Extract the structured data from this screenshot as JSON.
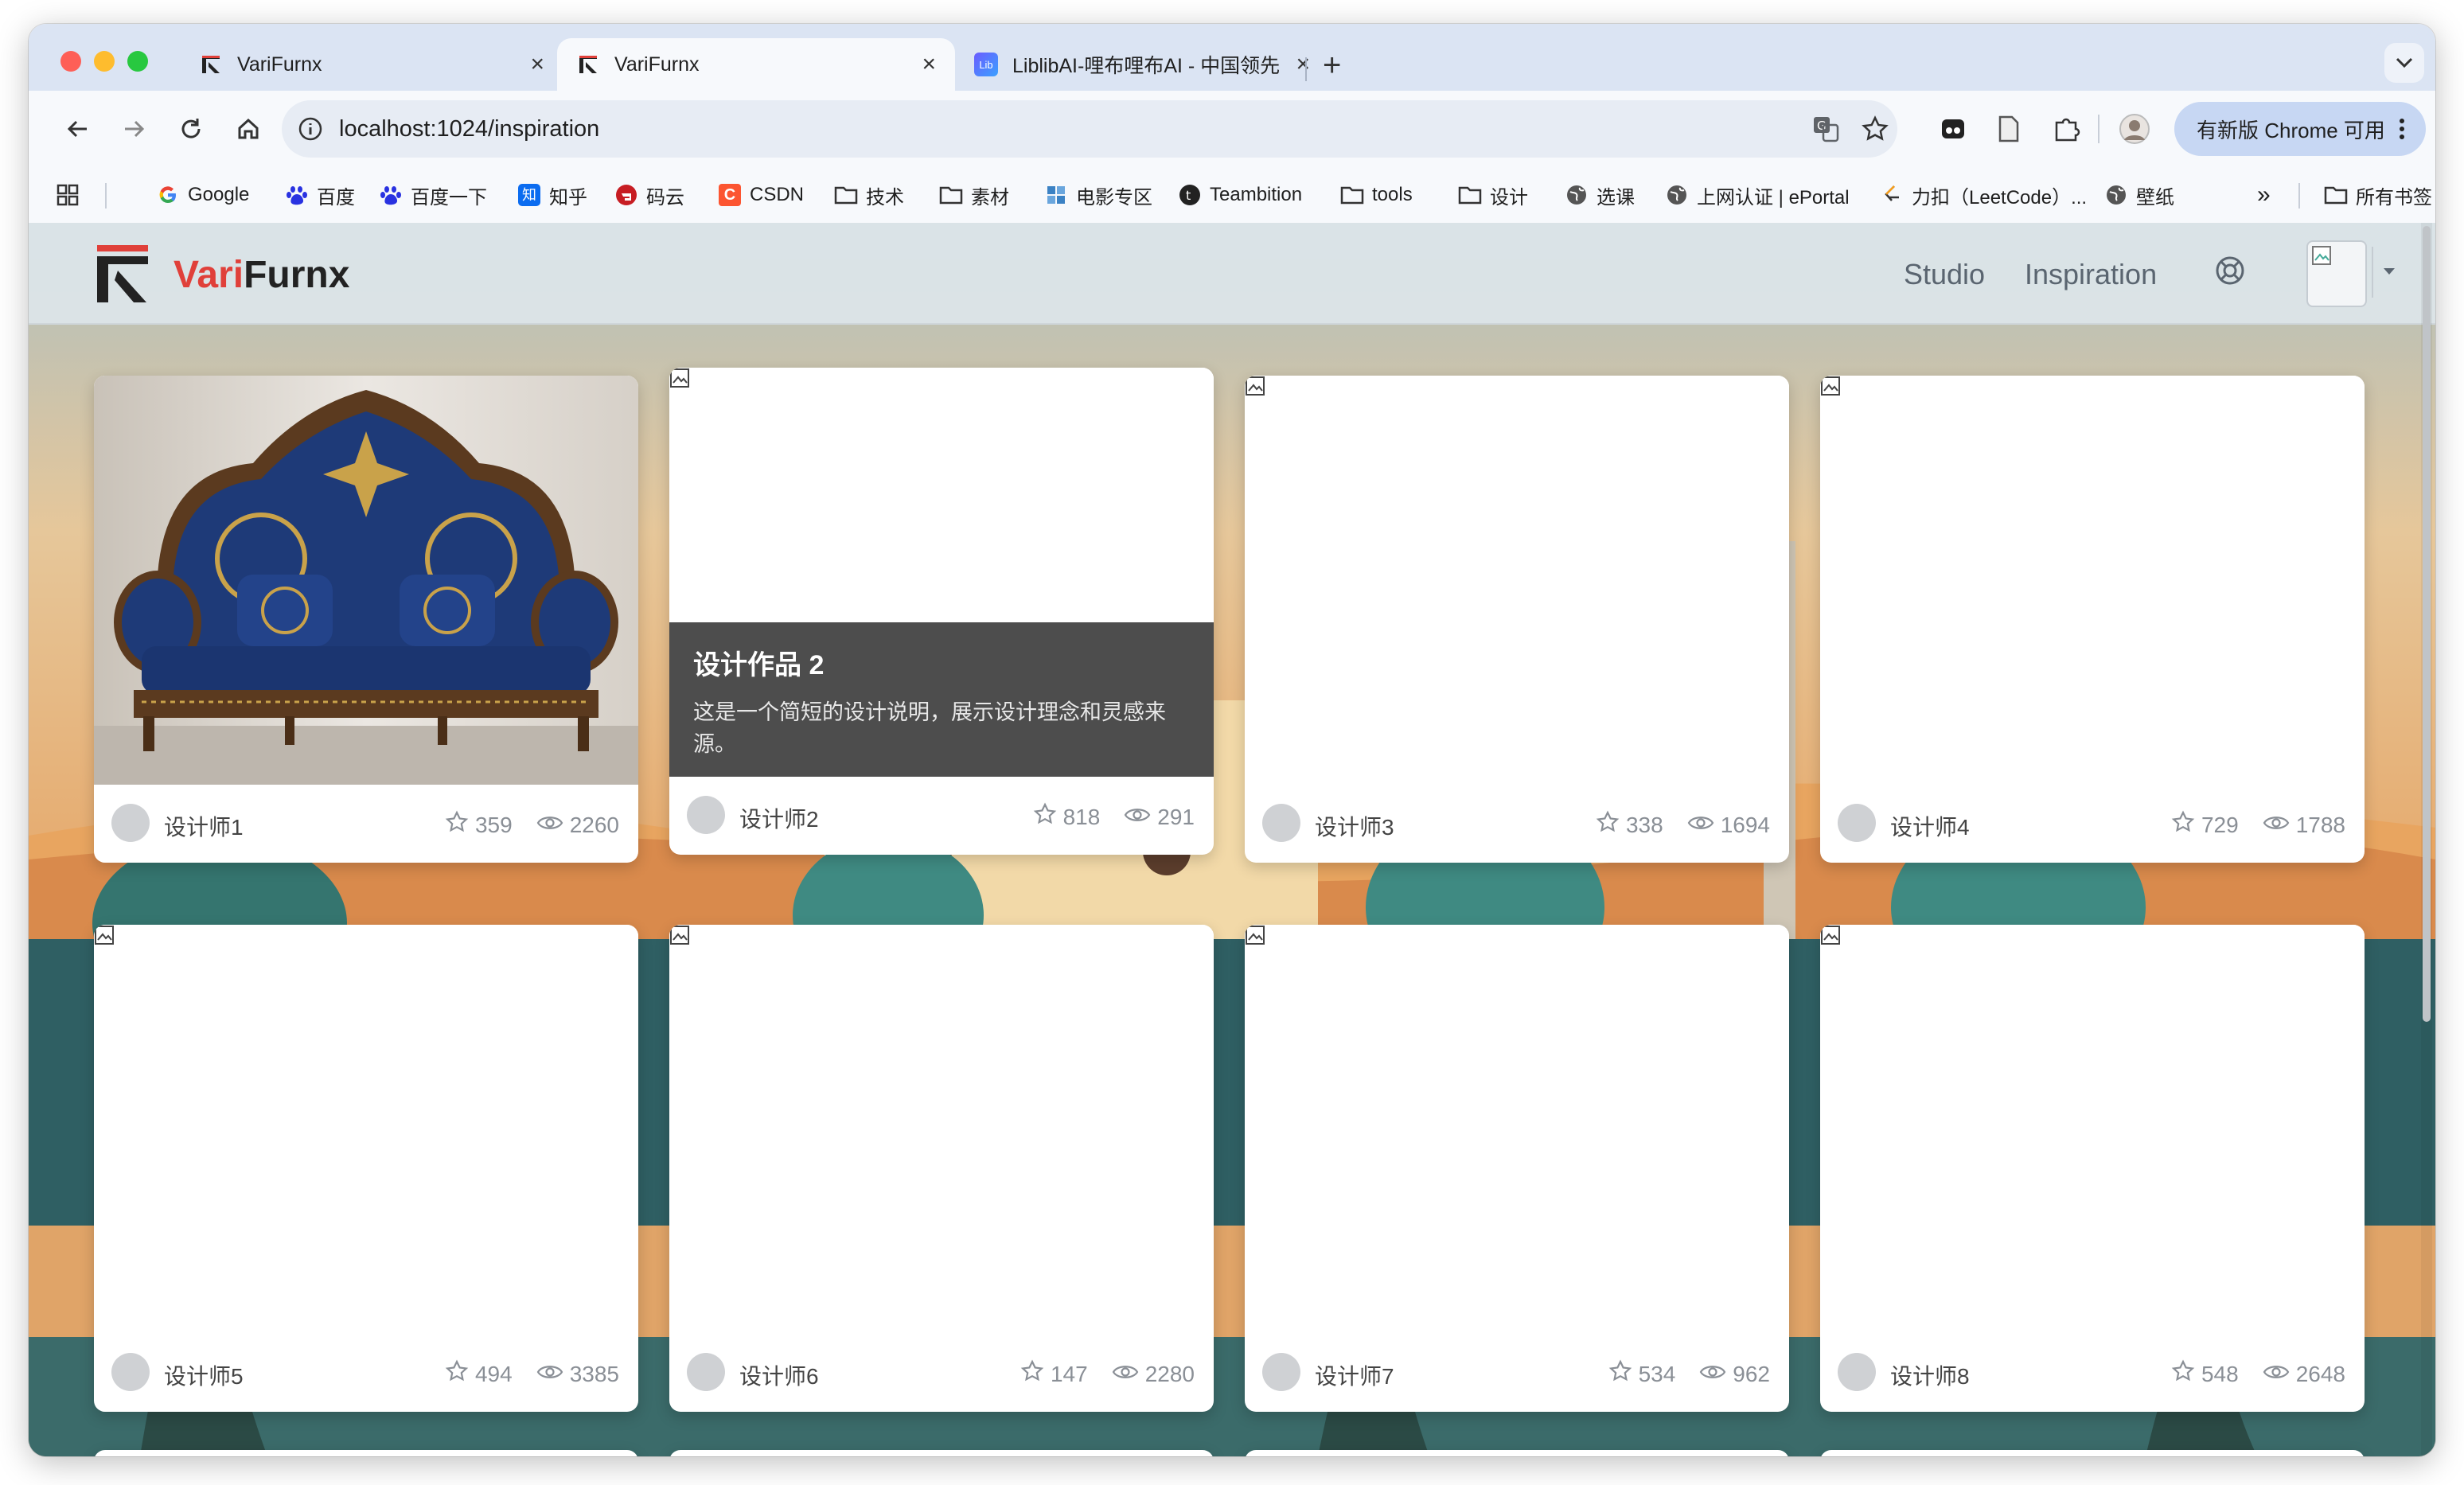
{
  "browser": {
    "tabs": [
      {
        "title": "VariFurnx",
        "active": false
      },
      {
        "title": "VariFurnx",
        "active": true
      },
      {
        "title": "LiblibAI-哩布哩布AI - 中国领先",
        "active": false
      }
    ],
    "url": "localhost:1024/inspiration",
    "update_label": "有新版 Chrome 可用",
    "bookmarks": [
      {
        "label": "Google",
        "icon": "google-icon"
      },
      {
        "label": "百度",
        "icon": "baidu-icon"
      },
      {
        "label": "百度一下",
        "icon": "baidu-icon"
      },
      {
        "label": "知乎",
        "icon": "zhihu-icon"
      },
      {
        "label": "码云",
        "icon": "gitee-icon"
      },
      {
        "label": "CSDN",
        "icon": "csdn-icon"
      },
      {
        "label": "技术",
        "icon": "folder-icon"
      },
      {
        "label": "素材",
        "icon": "folder-icon"
      },
      {
        "label": "电影专区",
        "icon": "film-icon"
      },
      {
        "label": "Teambition",
        "icon": "teambition-icon"
      },
      {
        "label": "tools",
        "icon": "folder-icon"
      },
      {
        "label": "设计",
        "icon": "folder-icon"
      },
      {
        "label": "选课",
        "icon": "globe-icon"
      },
      {
        "label": "上网认证 | ePortal",
        "icon": "globe-icon"
      },
      {
        "label": "力扣（LeetCode）...",
        "icon": "leetcode-icon"
      },
      {
        "label": "壁纸",
        "icon": "globe-icon"
      }
    ],
    "more_bookmarks": "»",
    "all_bookmarks": "所有书签"
  },
  "app": {
    "logo_part1": "Vari",
    "logo_part2": "Furnx",
    "nav": [
      "Studio",
      "Inspiration"
    ],
    "accent_color": "#e0403a"
  },
  "cards": [
    {
      "designer": "设计师1",
      "stars": "359",
      "views": "2260",
      "has_image": true
    },
    {
      "designer": "设计师2",
      "stars": "818",
      "views": "291",
      "hover": true,
      "title": "设计作品 2",
      "description": "这是一个简短的设计说明，展示设计理念和灵感来源。"
    },
    {
      "designer": "设计师3",
      "stars": "338",
      "views": "1694"
    },
    {
      "designer": "设计师4",
      "stars": "729",
      "views": "1788"
    },
    {
      "designer": "设计师5",
      "stars": "494",
      "views": "3385"
    },
    {
      "designer": "设计师6",
      "stars": "147",
      "views": "2280"
    },
    {
      "designer": "设计师7",
      "stars": "534",
      "views": "962"
    },
    {
      "designer": "设计师8",
      "stars": "548",
      "views": "2648"
    }
  ]
}
